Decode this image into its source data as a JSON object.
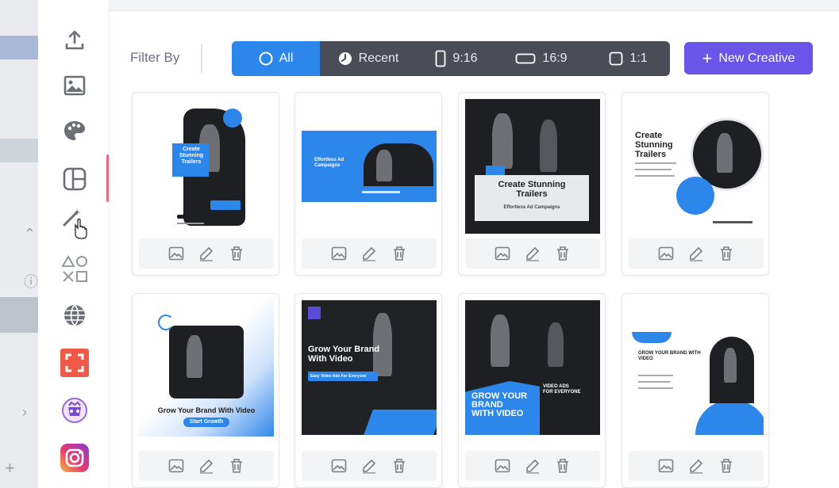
{
  "filter": {
    "label": "Filter By",
    "options": [
      {
        "label": "All",
        "icon": "circle-icon",
        "active": true
      },
      {
        "label": "Recent",
        "icon": "clock-icon",
        "active": false
      },
      {
        "label": "9:16",
        "icon": "portrait-rect-icon",
        "active": false
      },
      {
        "label": "16:9",
        "icon": "landscape-rect-icon",
        "active": false
      },
      {
        "label": "1:1",
        "icon": "square-rect-icon",
        "active": false
      }
    ]
  },
  "new_creative": {
    "label": "New Creative",
    "icon": "plus-icon"
  },
  "rail_icons": [
    "upload-icon",
    "image-icon",
    "palette-icon",
    "layout-icon",
    "magic-wand-icon",
    "shapes-icon",
    "globe-icon",
    "crop-app-icon",
    "badge-app-icon",
    "instagram-icon"
  ],
  "cards": [
    {
      "lines": [
        "Create",
        "Stunning",
        "Trailers"
      ]
    },
    {
      "lines": [
        "Effortless Ad",
        "Campaigns"
      ]
    },
    {
      "lines": [
        "Create Stunning",
        "Trailers",
        "Effortless Ad Campaigns"
      ]
    },
    {
      "lines": [
        "Create",
        "Stunning",
        "Trailers"
      ]
    },
    {
      "lines": [
        "Grow Your Brand With Video",
        "Start Growth"
      ]
    },
    {
      "lines": [
        "Grow Your Brand",
        "With Video",
        "Easy Video Ads For Everyone"
      ]
    },
    {
      "lines": [
        "GROW YOUR",
        "BRAND",
        "WITH VIDEO",
        "VIDEO ADS",
        "FOR EVERYONE"
      ]
    },
    {
      "lines": [
        "GROW YOUR BRAND WITH",
        "VIDEO"
      ]
    }
  ],
  "colors": {
    "accent_blue": "#2d86ea",
    "new_creative": "#6b55e8",
    "filter_bg": "#4a4d55"
  }
}
